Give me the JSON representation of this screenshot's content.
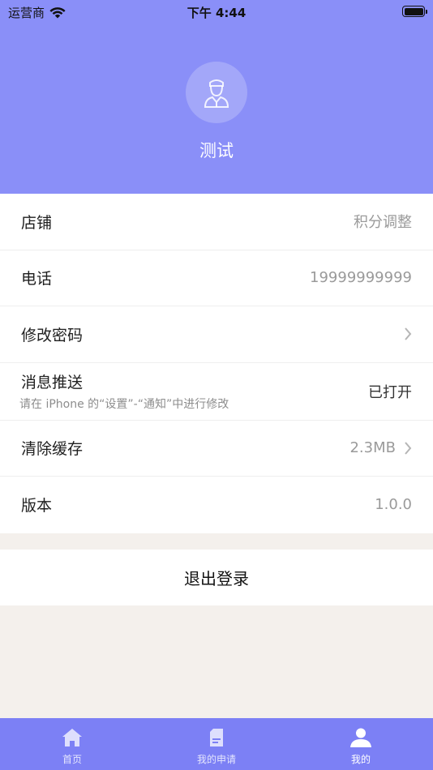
{
  "status_bar": {
    "carrier": "运营商",
    "time": "下午 4:44"
  },
  "profile": {
    "name": "测试",
    "avatar_icon": "user-avatar-icon"
  },
  "rows": {
    "shop": {
      "label": "店铺",
      "value": "积分调整"
    },
    "phone": {
      "label": "电话",
      "value": "19999999999"
    },
    "password": {
      "label": "修改密码"
    },
    "push": {
      "label": "消息推送",
      "sub": "请在 iPhone 的“设置”-“通知”中进行修改",
      "value": "已打开"
    },
    "cache": {
      "label": "清除缓存",
      "value": "2.3MB"
    },
    "version": {
      "label": "版本",
      "value": "1.0.0"
    }
  },
  "logout_label": "退出登录",
  "tabs": [
    {
      "label": "首页",
      "icon": "home-icon"
    },
    {
      "label": "我的申请",
      "icon": "document-icon"
    },
    {
      "label": "我的",
      "icon": "person-icon"
    }
  ],
  "colors": {
    "header": "#8a8ff8",
    "tabbar": "#7c80f5",
    "background": "#f4f0ec"
  }
}
